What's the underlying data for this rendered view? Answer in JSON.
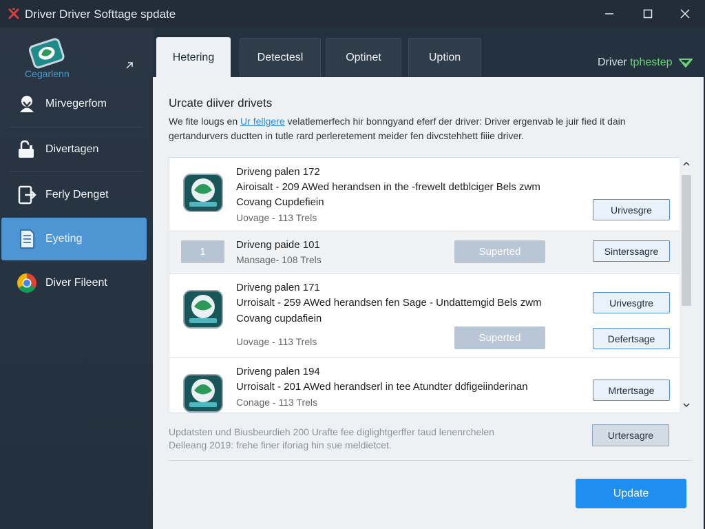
{
  "window": {
    "title": "Driver Driver Softtage spdate",
    "icons": {
      "app": "red-x-icon",
      "minimize": "minimize-icon",
      "maximize": "maximize-icon",
      "close": "close-icon"
    }
  },
  "sidebar": {
    "brand_label": "Cegarlenn",
    "items": [
      {
        "label": "Mirvegerfom",
        "icon": "user-shield-icon"
      },
      {
        "label": "Divertagen",
        "icon": "lock-hand-icon"
      },
      {
        "label": "Ferly Denget",
        "icon": "exit-device-icon"
      },
      {
        "label": "Eyeting",
        "icon": "document-icon"
      },
      {
        "label": "Diver Fileent",
        "icon": "chrome-icon"
      }
    ],
    "active_index": 3
  },
  "tabs": [
    {
      "label": "Hetering"
    },
    {
      "label": "Detectesl"
    },
    {
      "label": "Optinet"
    },
    {
      "label": "Uption"
    }
  ],
  "active_tab": 0,
  "tab_right": {
    "prefix": "Driver ",
    "accent": "tphestep"
  },
  "main": {
    "heading": "Urcate diiver drivets",
    "desc_before": "We fite lougs en ",
    "desc_link": "Ur fellgere",
    "desc_after": " velatlemerfech hir bonngyand eferf der driver: Driver ergenvab le juir fied it dain gertandurvers ductten in tutle rard perleretement meider fen divcstehhett fiiie driver.",
    "rows": [
      {
        "title": "Driveng palen 172",
        "text": "Airoisalt - 209 AWed herandsen in the -frewelt detblciger Bels zwm",
        "text2": "Covang Cupdefiein",
        "meta": "Uovage - 113 Trels",
        "button": "Urivesgre"
      },
      {
        "number": "1",
        "title": "Driveng paide 101",
        "meta": "Mansage- 108 Trels",
        "status": "Superted",
        "button": "Sinterssagre"
      },
      {
        "title": "Driveng palen 171",
        "text": "Urroisalt - 259 AWed herandsen fen Sage - Undattemgid Bels zwm",
        "text2": "Covang cupdafiein",
        "meta": "Uovage - 113 Trels",
        "status": "Superted",
        "button": "Urivesgtre",
        "button2": "Defertsage"
      },
      {
        "title": "Driveng palen 194",
        "text": "Urroisalt - 201 AWed herandserl in tee Atundter ddfigeiinderinan",
        "meta": "Conage - 113 Trels",
        "button": "Mrtertsage"
      }
    ],
    "footer_text_1": "Updatsten und Biusbeurdieh 200 Urafte fee diglightgerffer taud lenenrchelen",
    "footer_text_2": "Delleang 2019: frehe finer iforiag hin sue meldietcet.",
    "footer_button": "Urtersagre",
    "update_button": "Update"
  }
}
